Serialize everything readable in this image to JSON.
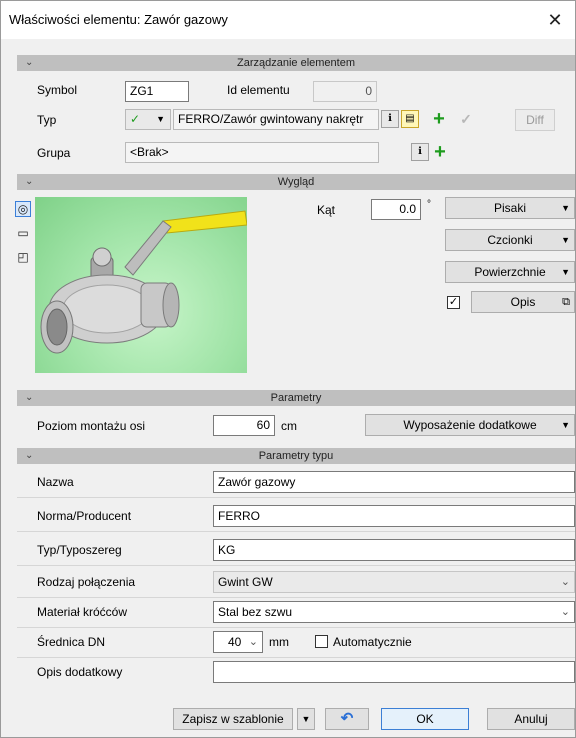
{
  "window": {
    "title": "Właściwości elementu: Zawór gazowy"
  },
  "zarzadzanie": {
    "header": "Zarządzanie elementem",
    "symbol_label": "Symbol",
    "symbol_value": "ZG1",
    "id_label": "Id elementu",
    "id_value": "0",
    "typ_label": "Typ",
    "typ_check": "✓",
    "typ_value": "FERRO/Zawór gwintowany nakrętr",
    "diff_label": "Diff",
    "grupa_label": "Grupa",
    "grupa_value": "<Brak>"
  },
  "wyglad": {
    "header": "Wygląd",
    "kat_label": "Kąt",
    "kat_value": "0.0",
    "kat_unit": "°",
    "pisaki": "Pisaki",
    "czcionki": "Czcionki",
    "powierzchnie": "Powierzchnie",
    "opis_checked": "✓",
    "opis": "Opis",
    "preview_bg": "#9fe3a6",
    "handle_color": "#f1e21a"
  },
  "parametry": {
    "header": "Parametry",
    "poziom_label": "Poziom montażu osi",
    "poziom_value": "60",
    "poziom_unit": "cm",
    "wyposazenie": "Wyposażenie dodatkowe"
  },
  "parametry_typu": {
    "header": "Parametry typu",
    "rows": [
      {
        "label": "Nazwa",
        "value": "Zawór gazowy"
      },
      {
        "label": "Norma/Producent",
        "value": "FERRO"
      },
      {
        "label": "Typ/Typoszereg",
        "value": "KG"
      },
      {
        "label": "Rodzaj połączenia",
        "value": "Gwint GW"
      },
      {
        "label": "Materiał króćców",
        "value": "Stal bez szwu"
      },
      {
        "label": "Średnica DN",
        "value": "40"
      },
      {
        "label": "Opis dodatkowy",
        "value": ""
      }
    ],
    "dn_unit": "mm",
    "auto_label": "Automatycznie"
  },
  "footer": {
    "zapisz": "Zapisz w szablonie",
    "ok": "OK",
    "anuluj": "Anuluj"
  }
}
